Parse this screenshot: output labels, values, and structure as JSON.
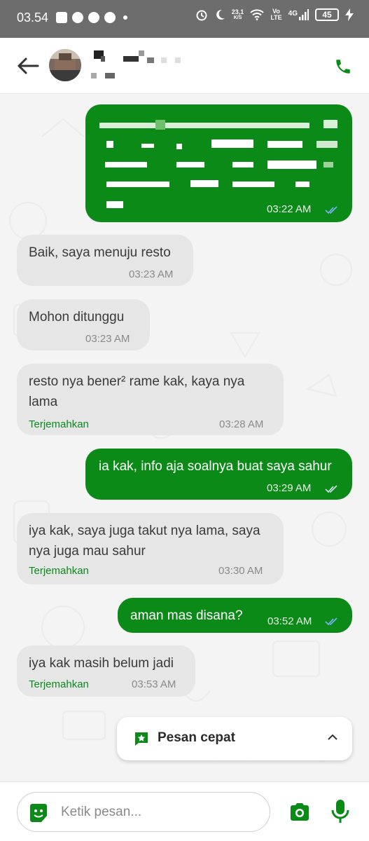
{
  "status_bar": {
    "time": "03.54",
    "net_speed_value": "23,1",
    "net_speed_unit": "K/S",
    "volte_top": "Vo",
    "volte_bottom": "LTE",
    "network": "4G",
    "battery": "45"
  },
  "header": {
    "contact_name": "",
    "contact_status": "",
    "back_icon": "arrow-left-icon",
    "call_icon": "phone-icon"
  },
  "messages": [
    {
      "direction": "out",
      "text": "",
      "time": "03:22 AM",
      "status": "read"
    },
    {
      "direction": "in",
      "text": "Baik, saya menuju resto",
      "time": "03:23 AM"
    },
    {
      "direction": "in",
      "text": "Mohon ditunggu",
      "time": "03:23 AM"
    },
    {
      "direction": "in",
      "text_line1": "resto nya bener² rame kak, kaya nya",
      "text_line2": "lama",
      "translate": "Terjemahkan",
      "time": "03:28 AM"
    },
    {
      "direction": "out",
      "text": "ia kak, info aja soalnya buat saya sahur",
      "time": "03:29 AM",
      "status": "read"
    },
    {
      "direction": "in",
      "text_line1": "iya kak, saya juga takut nya lama, saya",
      "text_line2": "nya juga mau sahur",
      "translate": "Terjemahkan",
      "time": "03:30 AM"
    },
    {
      "direction": "out",
      "text": "aman mas disana?",
      "time": "03:52 AM",
      "status": "read"
    },
    {
      "direction": "in",
      "text": "iya kak masih belum jadi",
      "translate": "Terjemahkan",
      "time": "03:53 AM"
    }
  ],
  "quick_reply": {
    "label": "Pesan cepat",
    "icon": "star-chat-icon",
    "chevron": "chevron-up-icon"
  },
  "composer": {
    "placeholder": "Ketik pesan...",
    "value": "",
    "sticker_icon": "smile-sticker-icon",
    "camera_icon": "camera-icon",
    "mic_icon": "microphone-icon"
  },
  "colors": {
    "brand_green": "#0b8a17",
    "incoming_bubble": "#e6e6e6",
    "status_bar": "#6d6d6d",
    "read_tick": "#7fb2ff"
  }
}
